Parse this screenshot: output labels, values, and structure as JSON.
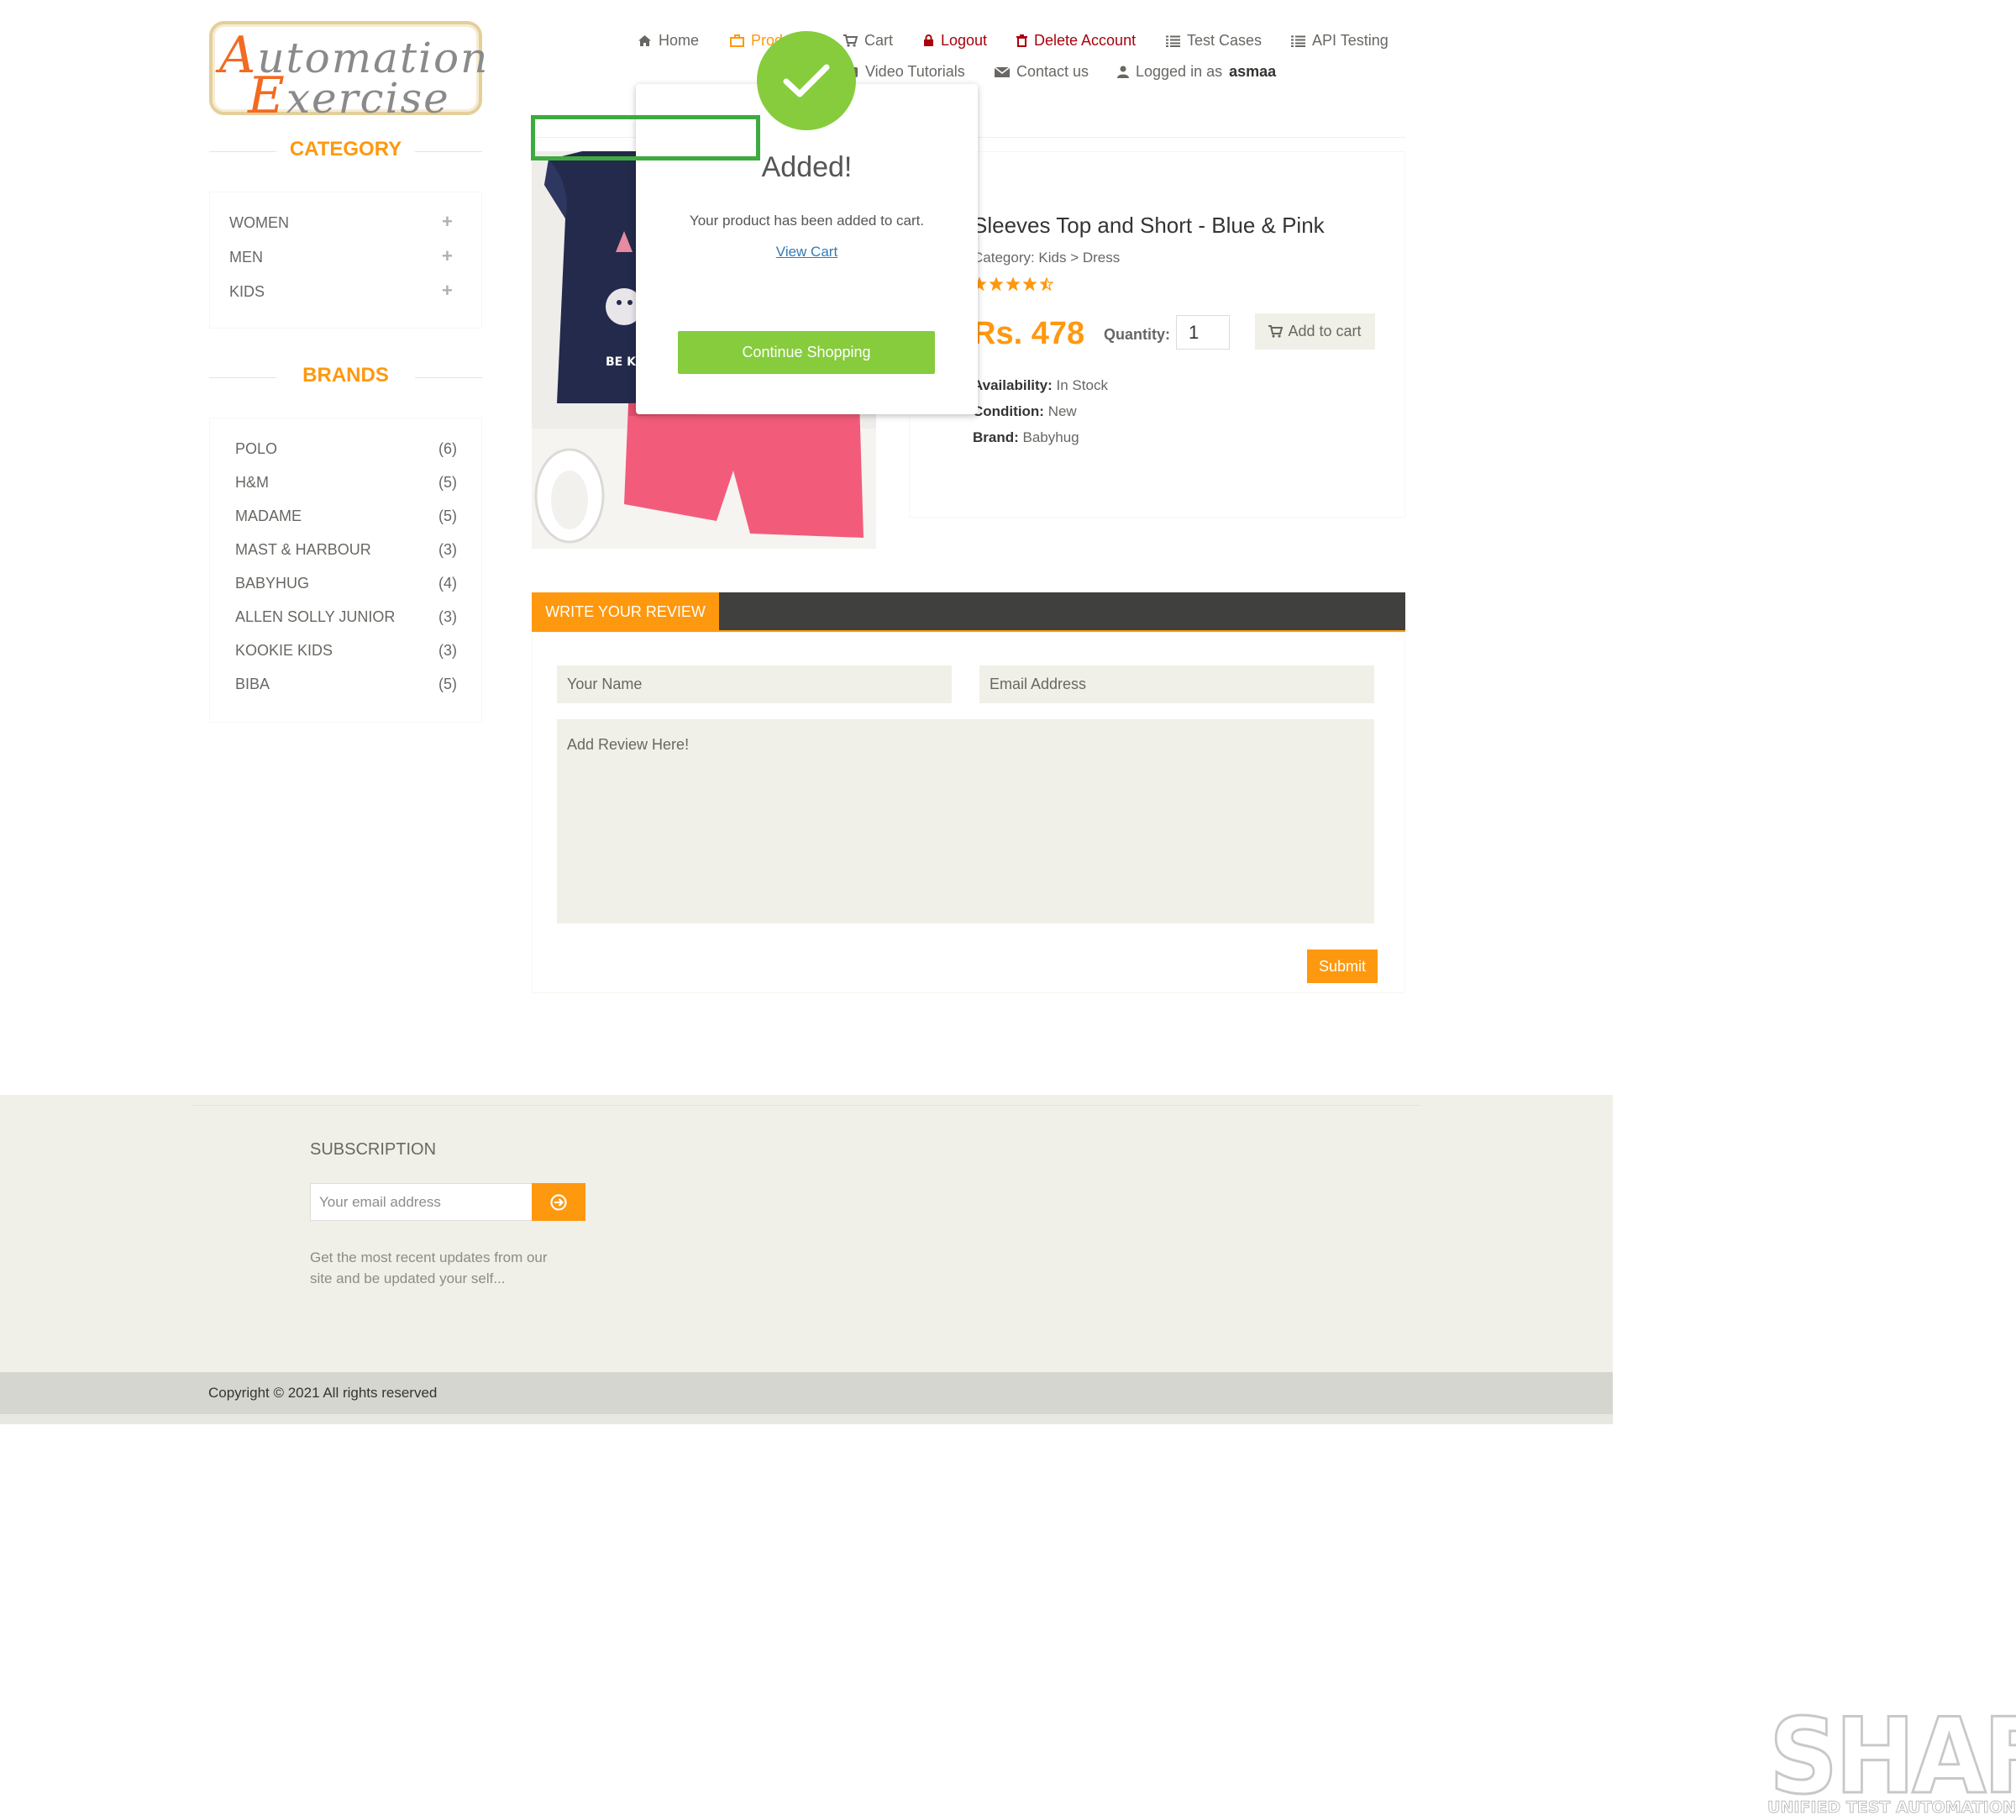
{
  "logo": {
    "line1": "Automation",
    "line2": "Exercise"
  },
  "nav": {
    "home": "Home",
    "products": "Products",
    "cart": "Cart",
    "logout": "Logout",
    "delete_account": "Delete Account",
    "test_cases": "Test Cases",
    "api_testing": "API Testing",
    "video_tutorials": "Video Tutorials",
    "contact_us": "Contact us",
    "logged_in_prefix": "Logged in as",
    "username": "asmaa"
  },
  "sidebar": {
    "category_title": "CATEGORY",
    "categories": [
      {
        "label": "WOMEN"
      },
      {
        "label": "MEN"
      },
      {
        "label": "KIDS"
      }
    ],
    "brands_title": "BRANDS",
    "brands": [
      {
        "name": "POLO",
        "count": "(6)"
      },
      {
        "name": "H&M",
        "count": "(5)"
      },
      {
        "name": "MADAME",
        "count": "(5)"
      },
      {
        "name": "MAST & HARBOUR",
        "count": "(3)"
      },
      {
        "name": "BABYHUG",
        "count": "(4)"
      },
      {
        "name": "ALLEN SOLLY JUNIOR",
        "count": "(3)"
      },
      {
        "name": "KOOKIE KIDS",
        "count": "(3)"
      },
      {
        "name": "BIBA",
        "count": "(5)"
      }
    ]
  },
  "product": {
    "title": "Sleeves Top and Short - Blue & Pink",
    "category": "Category: Kids > Dress",
    "rating": 4.5,
    "price": "Rs. 478",
    "quantity_label": "Quantity:",
    "quantity_value": "1",
    "add_to_cart": "Add to cart",
    "availability_label": "Availability:",
    "availability_value": "In Stock",
    "condition_label": "Condition:",
    "condition_value": "New",
    "brand_label": "Brand:",
    "brand_value": "Babyhug",
    "image_text": "BE KI"
  },
  "review": {
    "tab_label": "WRITE YOUR REVIEW",
    "name_placeholder": "Your Name",
    "email_placeholder": "Email Address",
    "review_placeholder": "Add Review Here!",
    "submit": "Submit"
  },
  "footer": {
    "subscription_title": "SUBSCRIPTION",
    "email_placeholder": "Your email address",
    "subscription_text": "Get the most recent updates from our site and be updated your self...",
    "copyright": "Copyright © 2021 All rights reserved"
  },
  "modal": {
    "title": "Added!",
    "message": "Your product has been added to cart.",
    "view_cart": "View Cart",
    "continue": "Continue Shopping"
  },
  "watermark": {
    "big": "SHAFT",
    "small": "UNIFIED TEST AUTOMATION ENGINE"
  },
  "colors": {
    "accent": "#fe980f",
    "success": "#86cc3d",
    "highlight_box": "#3dab3f",
    "danger": "#a9000b"
  },
  "icons": [
    "home-icon",
    "products-icon",
    "cart-icon",
    "lock-icon",
    "trash-icon",
    "list-icon",
    "youtube-icon",
    "envelope-icon",
    "user-icon",
    "plus-icon",
    "star-icon",
    "check-icon",
    "arrow-circle-right-icon"
  ]
}
